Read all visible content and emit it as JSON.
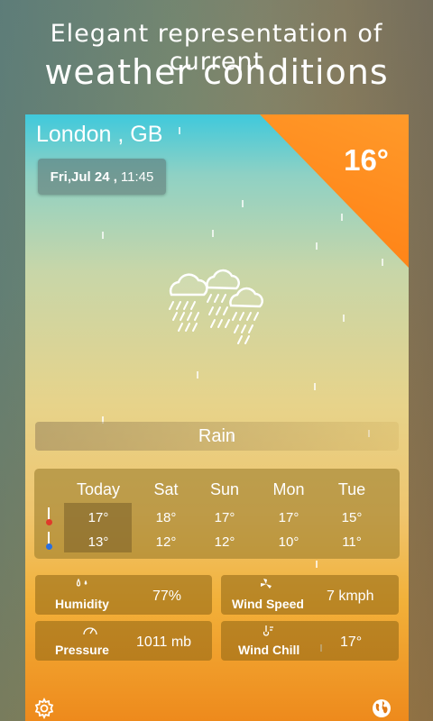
{
  "promo": {
    "line1": "Elegant representation of current",
    "line2": "weather conditions"
  },
  "header": {
    "location": "London , GB",
    "day": "Fri,Jul 24 ,",
    "time": "11:45",
    "temperature": "16°"
  },
  "condition": {
    "label": "Rain",
    "icon": "rain-cloud-icon"
  },
  "forecast": [
    {
      "day": "Today",
      "high": "17°",
      "low": "13°"
    },
    {
      "day": "Sat",
      "high": "18°",
      "low": "12°"
    },
    {
      "day": "Sun",
      "high": "17°",
      "low": "12°"
    },
    {
      "day": "Mon",
      "high": "17°",
      "low": "10°"
    },
    {
      "day": "Tue",
      "high": "15°",
      "low": "11°"
    }
  ],
  "stats": {
    "humidity": {
      "label": "Humidity",
      "value": "77%",
      "icon": "humidity-icon"
    },
    "wind_speed": {
      "label": "Wind Speed",
      "value": "7 kmph",
      "icon": "wind-turbine-icon"
    },
    "pressure": {
      "label": "Pressure",
      "value": "1011 mb",
      "icon": "gauge-icon"
    },
    "wind_chill": {
      "label": "Wind Chill",
      "value": "17°",
      "icon": "wind-chill-icon"
    }
  },
  "footer": {
    "settings_icon": "gear-icon",
    "globe_icon": "globe-icon"
  },
  "colors": {
    "accent_orange": "#ff8a1e",
    "high_temp": "#e03a2a",
    "low_temp": "#2a6fe0"
  }
}
